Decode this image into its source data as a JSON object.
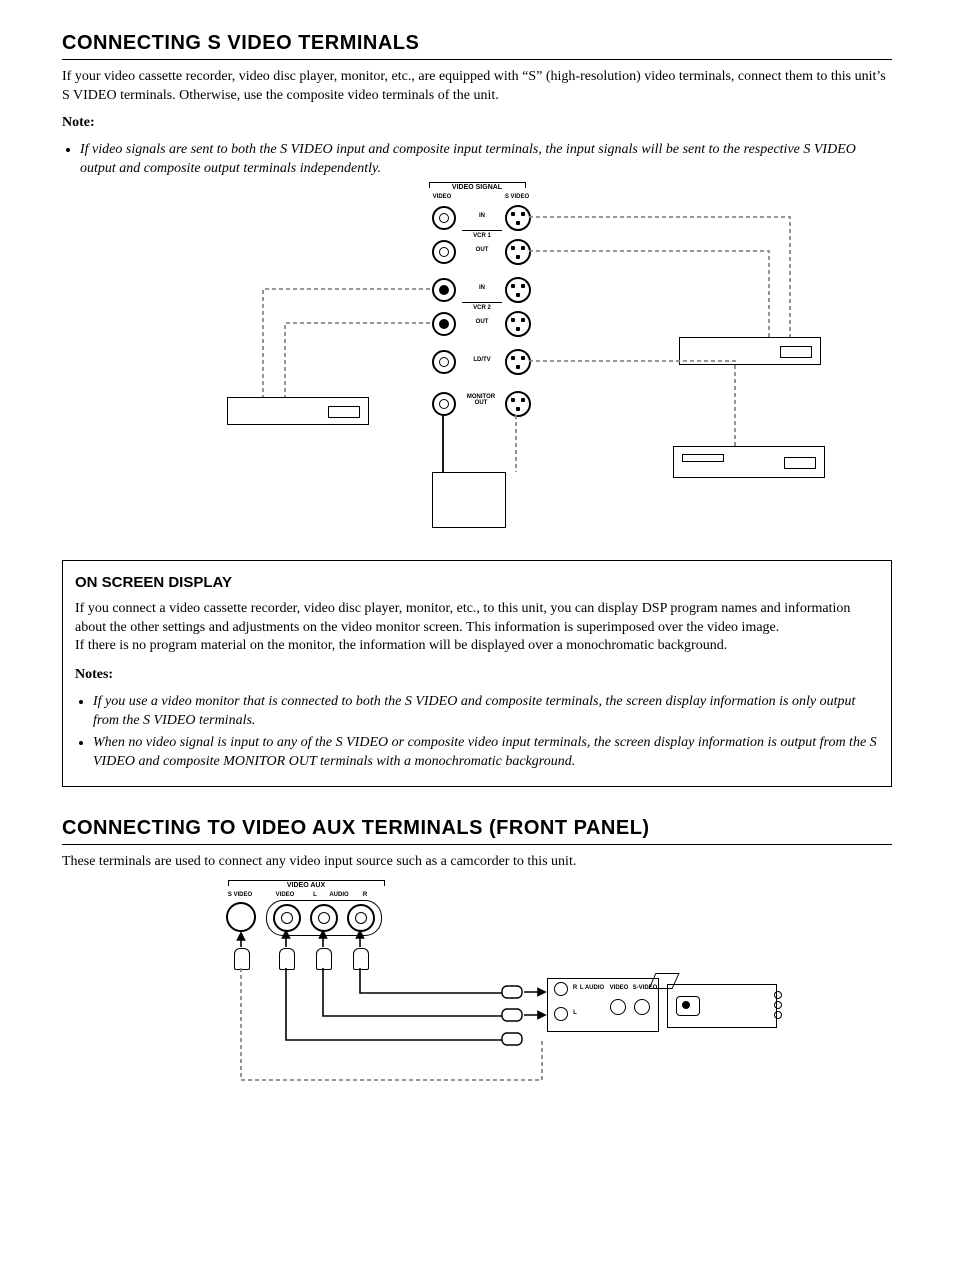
{
  "section1": {
    "title": "CONNECTING S VIDEO TERMINALS",
    "intro": "If your video cassette recorder, video disc player, monitor, etc., are equipped with “S” (high-resolution) video terminals, connect them to this unit’s S VIDEO terminals. Otherwise, use the composite video terminals of the unit.",
    "note_label": "Note:",
    "note_bullet": "If video signals are sent to both the S VIDEO input and composite input terminals, the input signals will be sent to the respective S VIDEO output and composite output terminals independently."
  },
  "diagram1_labels": {
    "header": "VIDEO SIGNAL",
    "col_video": "VIDEO",
    "col_svideo": "S VIDEO",
    "in": "IN",
    "out": "OUT",
    "vcr1": "VCR 1",
    "vcr2": "VCR 2",
    "ldtv": "LD/TV",
    "monitor_out": "MONITOR\nOUT"
  },
  "osd": {
    "title": "ON SCREEN DISPLAY",
    "para1": "If you connect a video cassette recorder, video disc player, monitor, etc., to this unit, you can display DSP program names and information about the other settings and adjustments on the video monitor screen. This information is superimposed over the video image.",
    "para2": "If there is no program material on the monitor, the information will be displayed over a monochromatic background.",
    "notes_label": "Notes:",
    "bullet1": "If you use a video monitor that is connected to both the S VIDEO and composite terminals, the screen display information is only output from the S VIDEO terminals.",
    "bullet2": "When no video signal is input to any of the S VIDEO or composite video input terminals, the screen display information is output from the S VIDEO and composite MONITOR OUT terminals with a monochromatic background."
  },
  "section2": {
    "title": "CONNECTING TO VIDEO AUX TERMINALS (FRONT PANEL)",
    "intro": "These terminals are used to connect any video input source such as a camcorder to this unit."
  },
  "diagram2_labels": {
    "header": "VIDEO AUX",
    "svideo": "S VIDEO",
    "video": "VIDEO",
    "l": "L",
    "r": "R",
    "audio": "AUDIO",
    "cam_r": "R",
    "cam_l": "L",
    "cam_laudio": "L AUDIO",
    "cam_video": "VIDEO",
    "cam_svideo": "S-VIDEO"
  }
}
